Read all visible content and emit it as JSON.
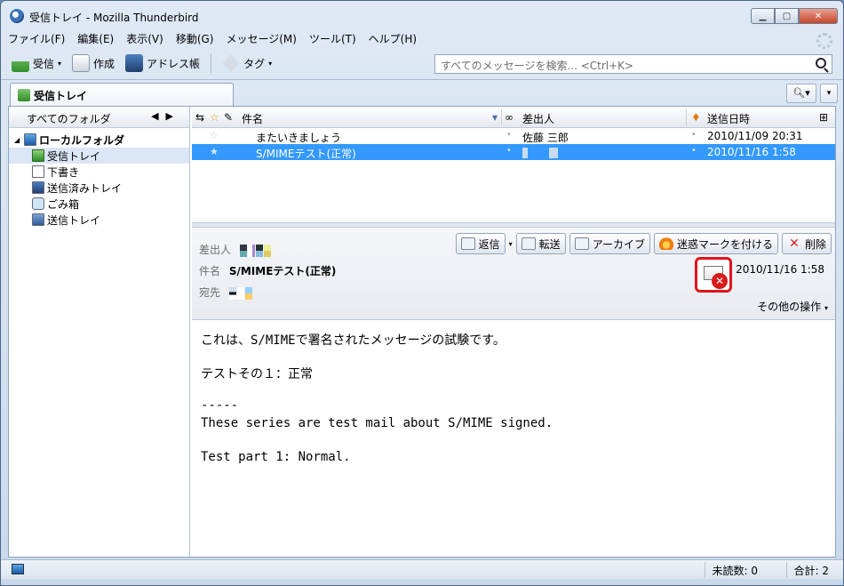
{
  "window": {
    "title": "受信トレイ - Mozilla Thunderbird"
  },
  "menu": [
    "ファイル(F)",
    "編集(E)",
    "表示(V)",
    "移動(G)",
    "メッセージ(M)",
    "ツール(T)",
    "ヘルプ(H)"
  ],
  "toolbar": {
    "get_mail": "受信",
    "compose": "作成",
    "address_book": "アドレス帳",
    "tag": "タグ"
  },
  "search": {
    "placeholder": "すべてのメッセージを検索... <Ctrl+K>"
  },
  "tab": {
    "label": "受信トレイ"
  },
  "folder_pane": {
    "header": "すべてのフォルダ",
    "root": "ローカルフォルダ",
    "folders": [
      "受信トレイ",
      "下書き",
      "送信済みトレイ",
      "ごみ箱",
      "送信トレイ"
    ]
  },
  "message_list": {
    "columns": {
      "subject": "件名",
      "sender": "差出人",
      "date": "送信日時"
    },
    "rows": [
      {
        "subject": "またいきましょう",
        "sender": "佐藤 三郎",
        "date": "2010/11/09 20:31"
      },
      {
        "subject": "S/MIMEテスト(正常)",
        "sender": "",
        "date": "2010/11/16 1:58"
      }
    ]
  },
  "message_header": {
    "from_label": "差出人",
    "subject_label": "件名",
    "subject": "S/MIMEテスト(正常)",
    "to_label": "宛先",
    "date": "2010/11/16 1:58",
    "other_actions": "その他の操作"
  },
  "actions": {
    "reply": "返信",
    "forward": "転送",
    "archive": "アーカイブ",
    "junk": "迷惑マークを付ける",
    "delete": "削除"
  },
  "body": {
    "lines": [
      "これは、S/MIMEで署名されたメッセージの試験です。",
      "テストその１：正常",
      "-----",
      "These series are test mail about S/MIME signed.",
      "Test part 1: Normal."
    ]
  },
  "status": {
    "unread": "未読数: 0",
    "total": "合計: 2"
  }
}
